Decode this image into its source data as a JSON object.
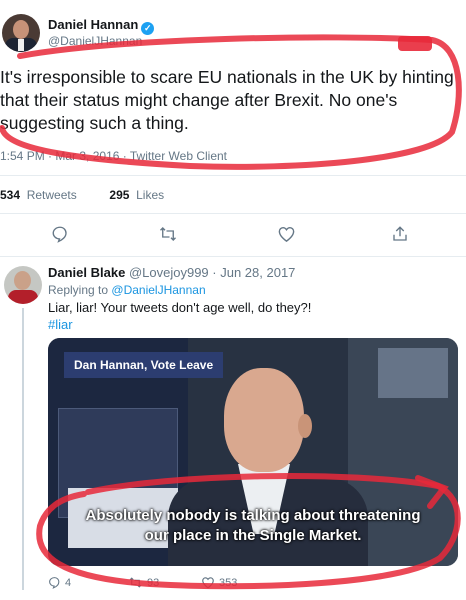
{
  "main_tweet": {
    "author_name": "Daniel Hannan",
    "verified_badge": "✓",
    "handle": "@DanielJHannan",
    "text": "It's irresponsible to scare EU nationals in the UK by hinting that their status might change after Brexit. No one's suggesting such a thing.",
    "time": "1:54 PM",
    "date": "Mar 3, 2016",
    "client": "Twitter Web Client",
    "retweets_count": "534",
    "retweets_label": "Retweets",
    "likes_count": "295",
    "likes_label": "Likes",
    "icons": [
      "reply-icon",
      "retweet-icon",
      "like-icon",
      "share-icon"
    ]
  },
  "reply_tweet": {
    "author_name": "Daniel Blake",
    "handle": "@Lovejoy999",
    "date": "Jun 28, 2017",
    "replying_prefix": "Replying to",
    "replying_to": "@DanielJHannan",
    "text": "Liar, liar! Your tweets don't age well, do they?!",
    "hashtag": "#liar",
    "media": {
      "lower_third": "Dan Hannan, Vote Leave",
      "subtitle_line1": "Absolutely nobody is talking about threatening",
      "subtitle_line2": "our place in the Single Market."
    },
    "reply_count": "4",
    "retweet_count": "93",
    "like_count": "353"
  },
  "colors": {
    "marker_red": "#e8293a",
    "link_blue": "#1b95e0",
    "secondary_gray": "#657786"
  }
}
